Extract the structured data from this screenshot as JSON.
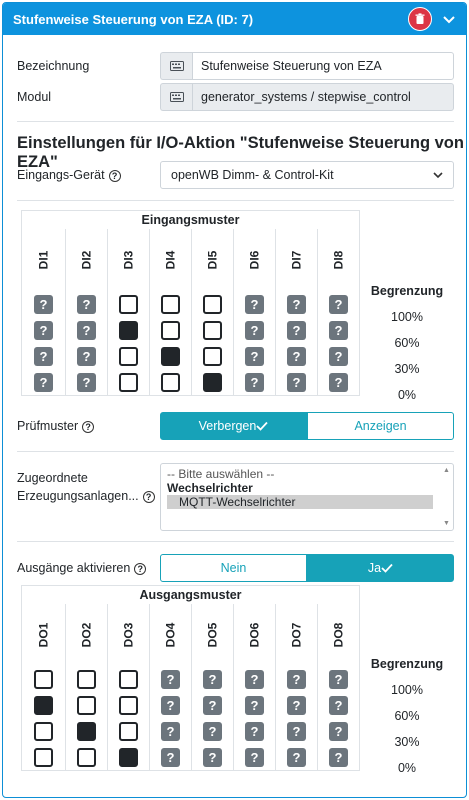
{
  "header": {
    "title": "Stufenweise Steuerung von EZA (ID: 7)"
  },
  "fields": {
    "bezeichnung_label": "Bezeichnung",
    "bezeichnung_value": "Stufenweise Steuerung von EZA",
    "modul_label": "Modul",
    "modul_value": "generator_systems / stepwise_control"
  },
  "settings": {
    "heading": "Einstellungen für I/O-Aktion \"Stufenweise Steuerung von EZA\"",
    "device_label": "Eingangs-Gerät",
    "device_value": "openWB Dimm- & Control-Kit"
  },
  "input_matrix": {
    "title": "Eingangsmuster",
    "columns": [
      "DI1",
      "DI2",
      "DI3",
      "DI4",
      "DI5",
      "DI6",
      "DI7",
      "DI8"
    ],
    "rows": [
      [
        "q",
        "q",
        "off",
        "off",
        "off",
        "q",
        "q",
        "q"
      ],
      [
        "q",
        "q",
        "on",
        "off",
        "off",
        "q",
        "q",
        "q"
      ],
      [
        "q",
        "q",
        "off",
        "on",
        "off",
        "q",
        "q",
        "q"
      ],
      [
        "q",
        "q",
        "off",
        "off",
        "on",
        "q",
        "q",
        "q"
      ]
    ]
  },
  "limits": {
    "heading": "Begrenzung",
    "values": [
      "100%",
      "60%",
      "30%",
      "0%"
    ]
  },
  "pruefmuster": {
    "label": "Prüfmuster",
    "hide": "Verbergen",
    "show": "Anzeigen"
  },
  "generators": {
    "label_line1": "Zugeordnete",
    "label_line2": "Erzeugungsanlagen...",
    "placeholder": "-- Bitte auswählen --",
    "group": "Wechselrichter",
    "option": "MQTT-Wechselrichter"
  },
  "outputs": {
    "label": "Ausgänge aktivieren",
    "no": "Nein",
    "yes": "Ja"
  },
  "output_matrix": {
    "title": "Ausgangsmuster",
    "columns": [
      "DO1",
      "DO2",
      "DO3",
      "DO4",
      "DO5",
      "DO6",
      "DO7",
      "DO8"
    ],
    "rows": [
      [
        "off",
        "off",
        "off",
        "q",
        "q",
        "q",
        "q",
        "q"
      ],
      [
        "on",
        "off",
        "off",
        "q",
        "q",
        "q",
        "q",
        "q"
      ],
      [
        "off",
        "on",
        "off",
        "q",
        "q",
        "q",
        "q",
        "q"
      ],
      [
        "off",
        "off",
        "on",
        "q",
        "q",
        "q",
        "q",
        "q"
      ]
    ]
  },
  "colors": {
    "header": "#0d93de",
    "accent": "#17a2b8",
    "danger": "#dc3545",
    "unknown": "#6c757d"
  }
}
